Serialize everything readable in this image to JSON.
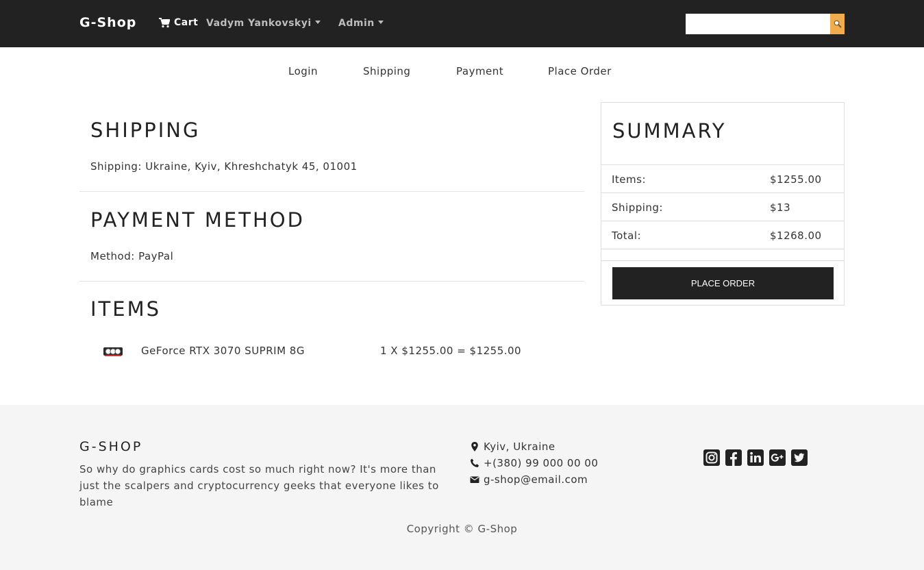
{
  "navbar": {
    "brand": "G-Shop",
    "cart_label": "Cart",
    "user_label": "Vadym Yankovskyi",
    "admin_label": "Admin",
    "search_placeholder": ""
  },
  "steps": [
    "Login",
    "Shipping",
    "Payment",
    "Place Order"
  ],
  "shipping": {
    "title": "SHIPPING",
    "text": "Shipping: Ukraine, Kyiv, Khreshchatyk 45, 01001"
  },
  "payment": {
    "title": "PAYMENT METHOD",
    "text": "Method: PayPal"
  },
  "items": {
    "title": "ITEMS",
    "list": [
      {
        "name": "GeForce RTX 3070 SUPRIM 8G",
        "calc": "1 X $1255.00 = $1255.00"
      }
    ]
  },
  "summary": {
    "title": "SUMMARY",
    "rows": [
      {
        "label": "Items:",
        "value": "$1255.00"
      },
      {
        "label": "Shipping:",
        "value": "$13"
      },
      {
        "label": "Total:",
        "value": "$1268.00"
      }
    ],
    "button_label": "PLACE ORDER"
  },
  "footer": {
    "title": "G-SHOP",
    "description": "So why do graphics cards cost so much right now? It's more than just the scalpers and cryptocurrency geeks that everyone likes to blame",
    "location": "Kyiv, Ukraine",
    "phone": "+(380) 99 000 00 00",
    "email": "g-shop@email.com",
    "copyright": "Copyright © G-Shop"
  },
  "colors": {
    "navbar_bg": "#222222",
    "search_button": "#f0ad4e",
    "footer_bg": "#f5f5f5"
  }
}
